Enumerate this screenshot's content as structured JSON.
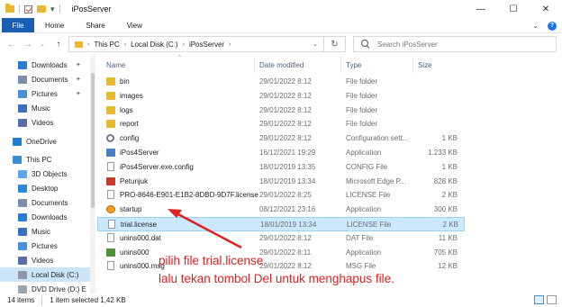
{
  "window": {
    "title": "iPosServer",
    "minimize_glyph": "—",
    "maximize_glyph": "☐",
    "close_glyph": "✕"
  },
  "ribbon": {
    "tabs": [
      "File",
      "Home",
      "Share",
      "View"
    ],
    "expand_glyph": "⌄",
    "help_glyph": "?"
  },
  "address": {
    "back_glyph": "←",
    "forward_glyph": "→",
    "recent_glyph": "⌄",
    "up_glyph": "↑",
    "crumbs": [
      "This PC",
      "Local Disk (C:)",
      "iPosServer"
    ],
    "crumb_sep": "›",
    "dropdown_glyph": "⌄",
    "refresh_glyph": "↻"
  },
  "search": {
    "placeholder": "Search iPosServer"
  },
  "nav": {
    "items": [
      {
        "label": "Downloads",
        "icon": "download-icon",
        "pinned": true
      },
      {
        "label": "Documents",
        "icon": "documents-icon",
        "pinned": true
      },
      {
        "label": "Pictures",
        "icon": "pictures-icon",
        "pinned": true
      },
      {
        "label": "Music",
        "icon": "music-icon"
      },
      {
        "label": "Videos",
        "icon": "videos-icon"
      },
      {
        "label": "OneDrive",
        "icon": "cloud-icon"
      },
      {
        "label": "This PC",
        "icon": "computer-icon"
      },
      {
        "label": "3D Objects",
        "icon": "cube-icon"
      },
      {
        "label": "Desktop",
        "icon": "desktop-icon"
      },
      {
        "label": "Documents",
        "icon": "documents-icon"
      },
      {
        "label": "Downloads",
        "icon": "download-icon"
      },
      {
        "label": "Music",
        "icon": "music-icon"
      },
      {
        "label": "Pictures",
        "icon": "pictures-icon"
      },
      {
        "label": "Videos",
        "icon": "videos-icon"
      },
      {
        "label": "Local Disk (C:)",
        "icon": "drive-icon",
        "selected": true
      },
      {
        "label": "DVD Drive (D:) E",
        "icon": "dvd-icon"
      }
    ],
    "pin_glyph": "✦"
  },
  "columns": {
    "name": "Name",
    "date": "Date modified",
    "type": "Type",
    "size": "Size",
    "sort_glyph": "^"
  },
  "files": [
    {
      "name": "bin",
      "date": "29/01/2022 8:12",
      "type": "File folder",
      "size": "",
      "icon": "folder-icon"
    },
    {
      "name": "images",
      "date": "29/01/2022 8:12",
      "type": "File folder",
      "size": "",
      "icon": "folder-icon"
    },
    {
      "name": "logs",
      "date": "29/01/2022 8:12",
      "type": "File folder",
      "size": "",
      "icon": "folder-icon"
    },
    {
      "name": "report",
      "date": "29/01/2022 8:12",
      "type": "File folder",
      "size": "",
      "icon": "folder-icon"
    },
    {
      "name": "config",
      "date": "29/01/2022 8:12",
      "type": "Configuration sett...",
      "size": "1 KB",
      "icon": "gear-icon"
    },
    {
      "name": "iPos4Server",
      "date": "16/12/2021 19:29",
      "type": "Application",
      "size": "1.233 KB",
      "icon": "app-icon"
    },
    {
      "name": "iPos4Server.exe.config",
      "date": "18/01/2019 13:35",
      "type": "CONFIG File",
      "size": "1 KB",
      "icon": "file-icon"
    },
    {
      "name": "Petunjuk",
      "date": "18/01/2019 13:34",
      "type": "Microsoft Edge P...",
      "size": "828 KB",
      "icon": "pdf-icon"
    },
    {
      "name": "PRO-8646-E901-E1B2-8DBD-9D7F.license",
      "date": "29/01/2022 8:25",
      "type": "LICENSE File",
      "size": "2 KB",
      "icon": "file-icon"
    },
    {
      "name": "startup",
      "date": "08/12/2021 23:16",
      "type": "Application",
      "size": "300 KB",
      "icon": "startup-icon"
    },
    {
      "name": "trial.license",
      "date": "18/01/2019 13:34",
      "type": "LICENSE File",
      "size": "2 KB",
      "icon": "file-icon",
      "selected": true
    },
    {
      "name": "unins000.dat",
      "date": "29/01/2022 8:12",
      "type": "DAT File",
      "size": "11 KB",
      "icon": "file-icon"
    },
    {
      "name": "unins000",
      "date": "29/01/2022 8:11",
      "type": "Application",
      "size": "705 KB",
      "icon": "uninstall-icon"
    },
    {
      "name": "unins000.msg",
      "date": "29/01/2022 8:12",
      "type": "MSG File",
      "size": "12 KB",
      "icon": "file-icon"
    }
  ],
  "annotation": {
    "line1": "pilih file trial.license",
    "line2": "lalu tekan tombol Del untuk menghapus file.",
    "color": "#e02020"
  },
  "status": {
    "count": "14 items",
    "selection": "1 item selected  1,42 KB"
  },
  "colors": {
    "accent": "#1a5fb4",
    "selection": "#cce8ff",
    "folder": "#e8b830"
  }
}
